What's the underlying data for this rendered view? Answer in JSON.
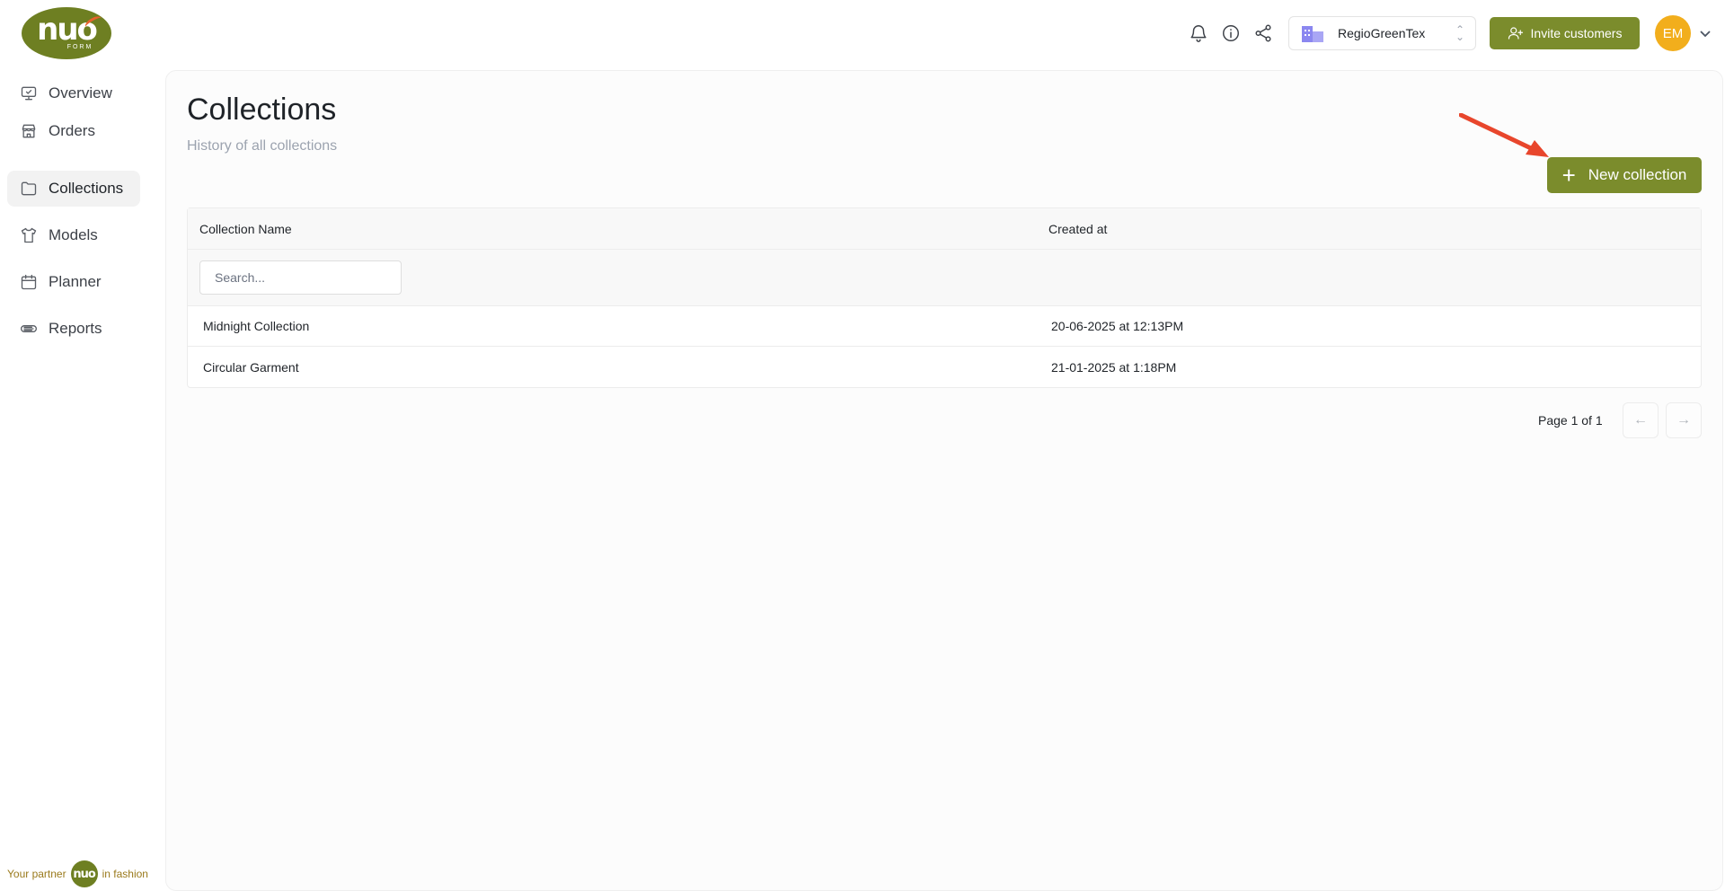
{
  "brand": {
    "logo_text": "nuo",
    "logo_sub": "FORM"
  },
  "sidebar": {
    "items": [
      {
        "label": "Overview",
        "icon": "monitor-icon"
      },
      {
        "label": "Orders",
        "icon": "store-icon"
      },
      {
        "label": "Collections",
        "icon": "folder-icon",
        "active": true
      },
      {
        "label": "Models",
        "icon": "shirt-icon"
      },
      {
        "label": "Planner",
        "icon": "calendar-icon"
      },
      {
        "label": "Reports",
        "icon": "reports-icon"
      }
    ],
    "footer": {
      "prefix": "Your partner",
      "logo_text": "nuo",
      "suffix": "in fashion"
    }
  },
  "topbar": {
    "icons": [
      "bell-icon",
      "info-icon",
      "share-icon"
    ],
    "org_name": "RegioGreenTex",
    "invite_label": "Invite customers",
    "avatar_initials": "EM"
  },
  "page": {
    "title": "Collections",
    "subtitle": "History of all collections",
    "new_button_label": "New collection"
  },
  "table": {
    "columns": [
      "Collection Name",
      "Created at"
    ],
    "search_placeholder": "Search...",
    "rows": [
      {
        "name": "Midnight Collection",
        "created": "20-06-2025 at 12:13PM"
      },
      {
        "name": "Circular Garment",
        "created": "21-01-2025 at 1:18PM"
      }
    ]
  },
  "pagination": {
    "label": "Page 1 of 1",
    "prev": "←",
    "next": "→"
  },
  "colors": {
    "accent": "#7b8c2c",
    "avatar": "#f2ae1c",
    "annotation_arrow": "#e8462c"
  }
}
